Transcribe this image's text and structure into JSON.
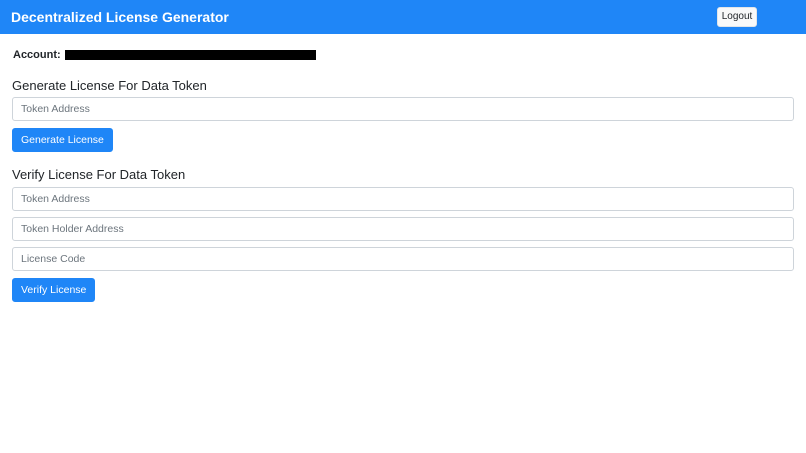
{
  "navbar": {
    "brand": "Decentralized License Generator",
    "logout_label": "Logout",
    "color": "#1f86f7"
  },
  "account": {
    "label": "Account:",
    "value_redacted": true
  },
  "generate": {
    "title": "Generate License For Data Token",
    "token_address_placeholder": "Token Address",
    "button_label": "Generate License"
  },
  "verify": {
    "title": "Verify License For Data Token",
    "token_address_placeholder": "Token Address",
    "holder_address_placeholder": "Token Holder Address",
    "license_code_placeholder": "License Code",
    "button_label": "Verify License"
  }
}
